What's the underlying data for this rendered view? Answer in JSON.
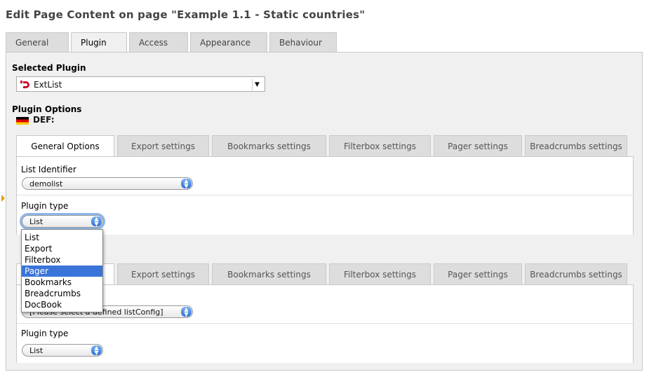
{
  "page_title": "Edit Page Content on page \"Example 1.1 - Static countries\"",
  "outer_tabs": [
    {
      "label": "General"
    },
    {
      "label": "Plugin"
    },
    {
      "label": "Access"
    },
    {
      "label": "Appearance"
    },
    {
      "label": "Behaviour"
    }
  ],
  "selected_plugin": {
    "heading": "Selected Plugin",
    "value": "ExtList"
  },
  "plugin_options": {
    "heading": "Plugin Options",
    "language": "DEF:"
  },
  "inner_tabs": [
    {
      "label": "General Options"
    },
    {
      "label": "Export settings"
    },
    {
      "label": "Bookmarks settings"
    },
    {
      "label": "Filterbox settings"
    },
    {
      "label": "Pager settings"
    },
    {
      "label": "Breadcrumbs settings"
    }
  ],
  "block1": {
    "list_identifier_label": "List Identifier",
    "list_identifier_value": "demolist",
    "plugin_type_label": "Plugin type",
    "plugin_type_value": "List"
  },
  "block2": {
    "list_identifier_value": "[Please select a defined listConfig]",
    "plugin_type_label": "Plugin type",
    "plugin_type_value": "List"
  },
  "dropdown": {
    "options": [
      "List",
      "Export",
      "Filterbox",
      "Pager",
      "Bookmarks",
      "Breadcrumbs",
      "DocBook"
    ],
    "highlighted": "Pager"
  },
  "colors": {
    "highlight": "#3a74d9",
    "plugin_icon": "#c8102e",
    "marker": "#e39c1b"
  }
}
